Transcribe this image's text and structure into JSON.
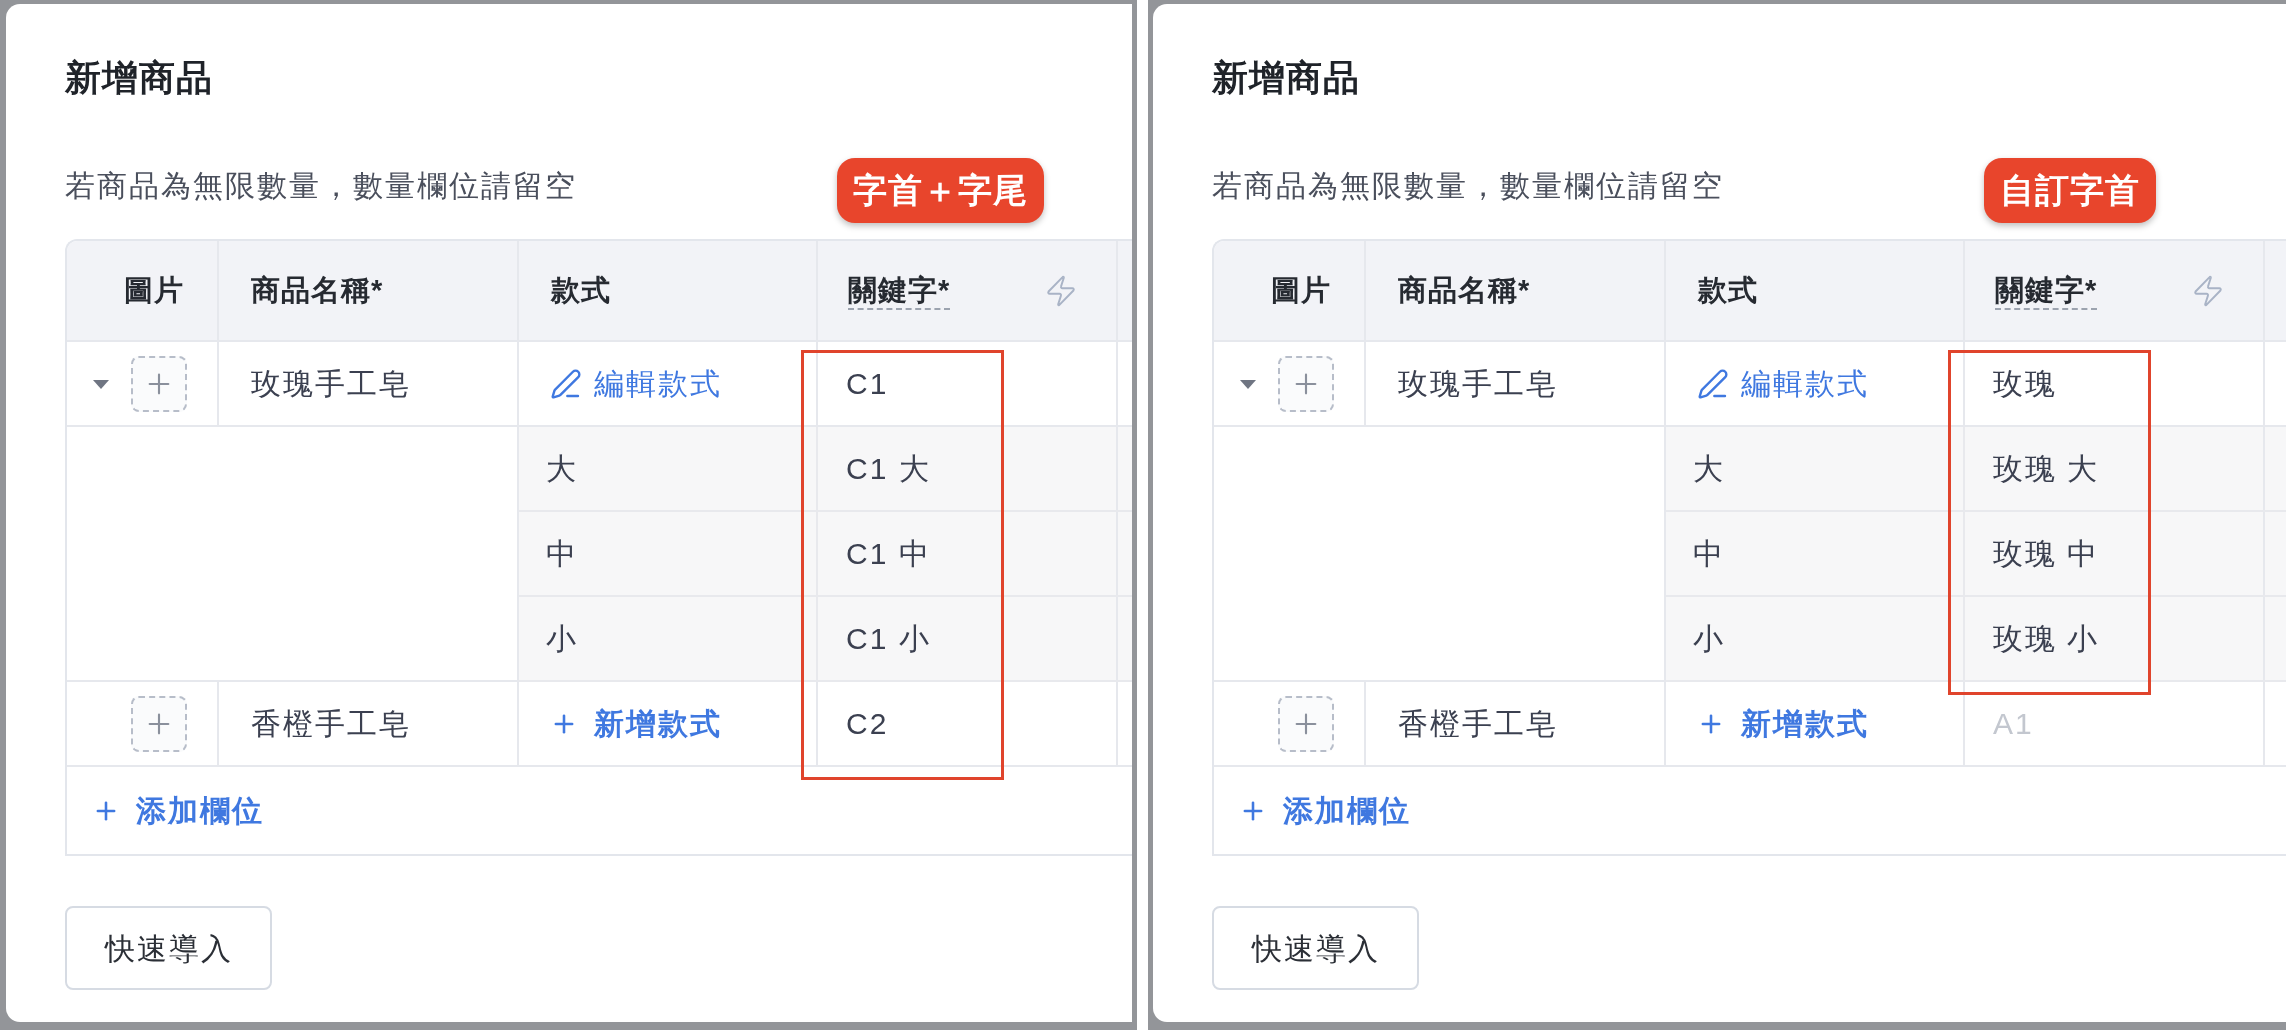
{
  "panels": [
    {
      "title": "新增商品",
      "hint": "若商品為無限數量，數量欄位請留空",
      "callout": "字首＋字尾",
      "columns": [
        {
          "kind": "image",
          "label": "圖片"
        },
        {
          "kind": "name",
          "label": "商品名稱*"
        },
        {
          "kind": "style",
          "label": "款式"
        },
        {
          "kind": "keyword",
          "label": "關鍵字*"
        }
      ],
      "products": [
        {
          "name": "玫瑰手工皂",
          "expanded": true,
          "style_action": {
            "kind": "edit",
            "label": "編輯款式"
          },
          "keyword": {
            "value": "C1",
            "highlighted": true
          },
          "variants": [
            {
              "style": "大",
              "keyword": {
                "value": "C1 大",
                "highlighted": true
              }
            },
            {
              "style": "中",
              "keyword": {
                "value": "C1 中",
                "highlighted": true
              }
            },
            {
              "style": "小",
              "keyword": {
                "value": "C1 小",
                "highlighted": true
              }
            }
          ]
        },
        {
          "name": "香橙手工皂",
          "style_action": {
            "kind": "add",
            "label": "新增款式"
          },
          "keyword": {
            "value": "C2",
            "highlighted": true
          }
        }
      ],
      "add_field": "添加欄位",
      "quick_import": "快速導入"
    },
    {
      "title": "新增商品",
      "hint": "若商品為無限數量，數量欄位請留空",
      "callout": "自訂字首",
      "columns": [
        {
          "kind": "image",
          "label": "圖片"
        },
        {
          "kind": "name",
          "label": "商品名稱*"
        },
        {
          "kind": "style",
          "label": "款式"
        },
        {
          "kind": "keyword",
          "label": "關鍵字*"
        }
      ],
      "products": [
        {
          "name": "玫瑰手工皂",
          "expanded": true,
          "style_action": {
            "kind": "edit",
            "label": "編輯款式"
          },
          "keyword": {
            "value": "玫瑰",
            "highlighted": true
          },
          "variants": [
            {
              "style": "大",
              "keyword": {
                "value": "玫瑰 大",
                "highlighted": true
              }
            },
            {
              "style": "中",
              "keyword": {
                "value": "玫瑰 中",
                "highlighted": true
              }
            },
            {
              "style": "小",
              "keyword": {
                "value": "玫瑰 小",
                "highlighted": true
              }
            }
          ]
        },
        {
          "name": "香橙手工皂",
          "style_action": {
            "kind": "add",
            "label": "新增款式"
          },
          "keyword": {
            "placeholder": "A1",
            "highlighted": false
          }
        }
      ],
      "add_field": "添加欄位",
      "quick_import": "快速導入"
    }
  ]
}
